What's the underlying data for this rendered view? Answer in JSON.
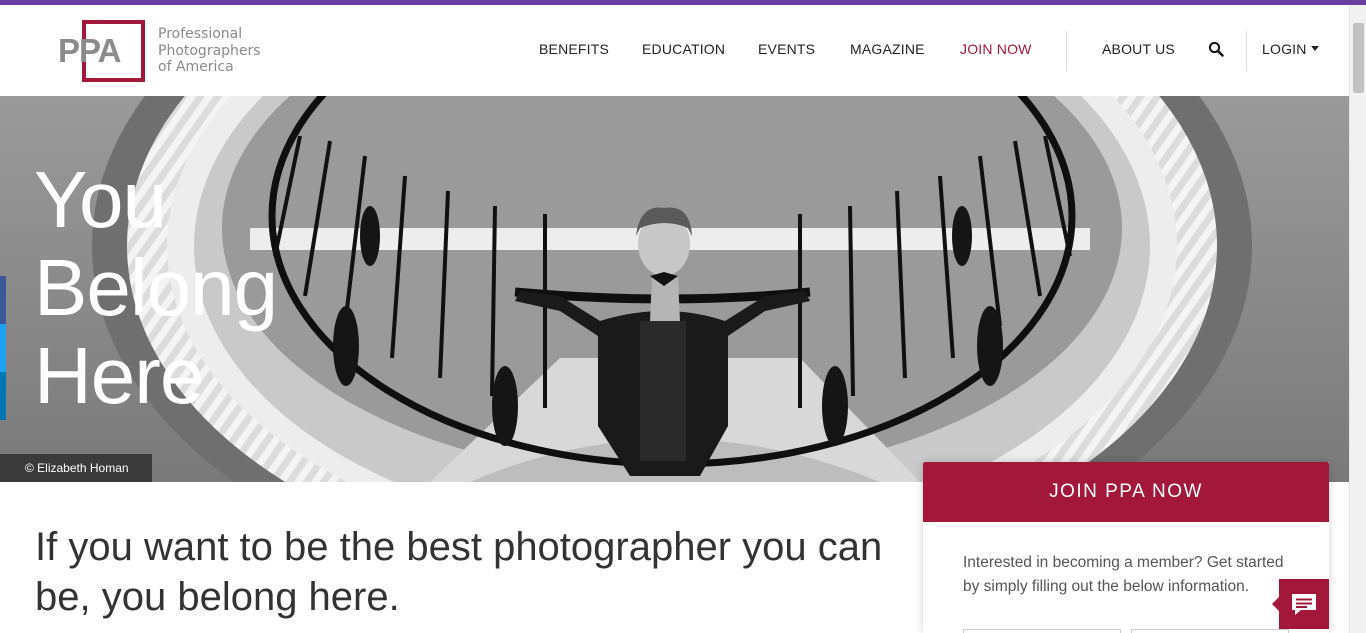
{
  "brand": {
    "logo_letters": "PPA",
    "logo_text_lines": [
      "Professional",
      "Photographers",
      "of America"
    ],
    "accent_color": "#a3173a",
    "top_bar_color": "#6b3fa0"
  },
  "nav": {
    "items": [
      {
        "label": "BENEFITS"
      },
      {
        "label": "EDUCATION"
      },
      {
        "label": "EVENTS"
      },
      {
        "label": "MAGAZINE"
      },
      {
        "label": "JOIN NOW"
      },
      {
        "label": "ABOUT US"
      }
    ],
    "search_icon": "search-icon",
    "login_label": "LOGIN"
  },
  "hero": {
    "title_lines": [
      "You",
      "Belong",
      "Here"
    ],
    "credit": "© Elizabeth Homan"
  },
  "social": {
    "colors": [
      "#3b5998",
      "#1da1f2",
      "#0077b5"
    ]
  },
  "main": {
    "tagline": "If you want to be the best photographer you can be, you belong here."
  },
  "join_card": {
    "heading": "JOIN PPA NOW",
    "intro": "Interested in becoming a member? Get started by simply filling out the below information."
  },
  "chat": {
    "icon": "chat-icon"
  }
}
